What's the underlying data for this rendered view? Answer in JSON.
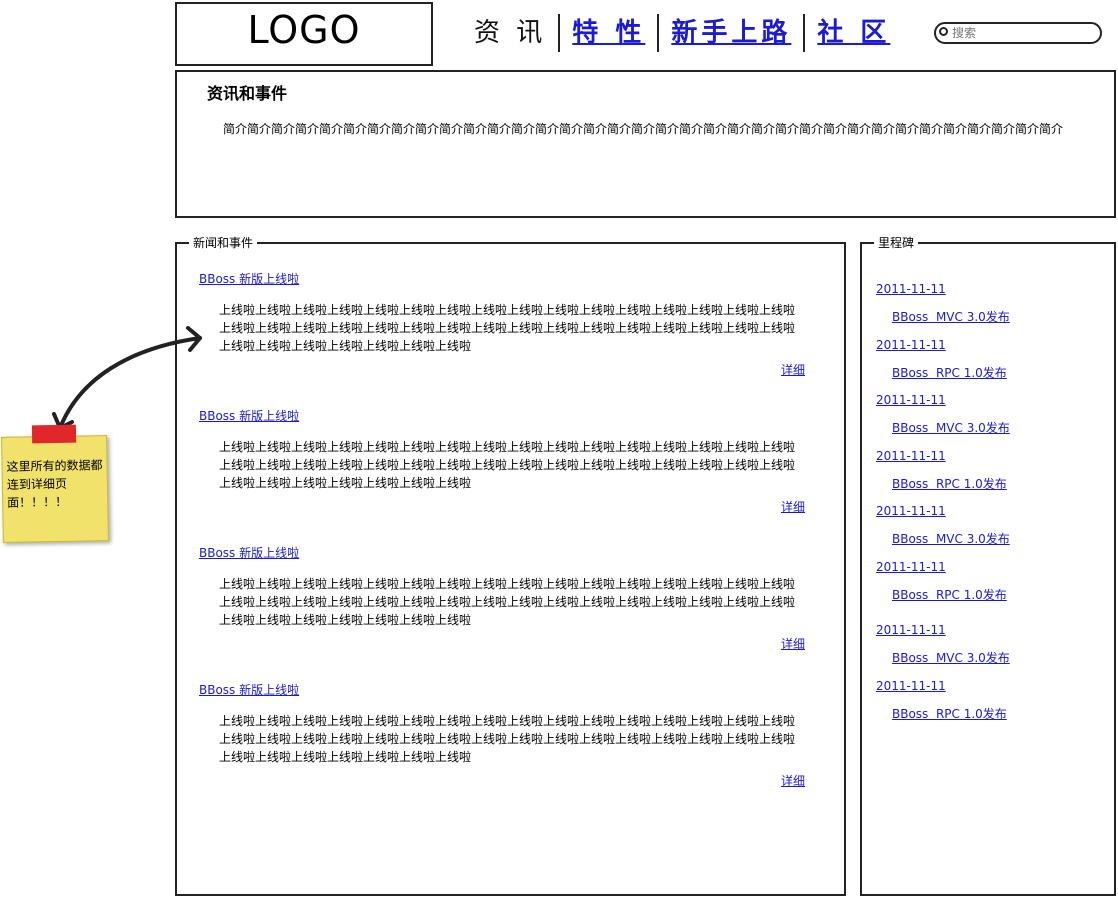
{
  "header": {
    "logo": "LOGO",
    "nav": [
      {
        "label": "资 讯",
        "current": true
      },
      {
        "label": "特 性"
      },
      {
        "label": "新手上路"
      },
      {
        "label": "社 区"
      }
    ],
    "search_placeholder": "搜索"
  },
  "intro": {
    "title": "资讯和事件",
    "text": "简介简介简介简介简介简介简介简介简介简介简介简介简介简介简介简介简介简介简介简介简介简介简介简介简介简介简介简介简介简介简介简介简介简介简介"
  },
  "news": {
    "legend": "新闻和事件",
    "items": [
      {
        "title": "BBoss 新版上线啦",
        "body": "上线啦上线啦上线啦上线啦上线啦上线啦上线啦上线啦上线啦上线啦上线啦上线啦上线啦上线啦上线啦上线啦上线啦上线啦上线啦上线啦上线啦上线啦上线啦上线啦上线啦上线啦上线啦上线啦上线啦上线啦上线啦上线啦上线啦上线啦上线啦上线啦上线啦上线啦上线啦",
        "more": "详细"
      },
      {
        "title": "BBoss 新版上线啦",
        "body": "上线啦上线啦上线啦上线啦上线啦上线啦上线啦上线啦上线啦上线啦上线啦上线啦上线啦上线啦上线啦上线啦上线啦上线啦上线啦上线啦上线啦上线啦上线啦上线啦上线啦上线啦上线啦上线啦上线啦上线啦上线啦上线啦上线啦上线啦上线啦上线啦上线啦上线啦上线啦",
        "more": "详细"
      },
      {
        "title": "BBoss 新版上线啦",
        "body": "上线啦上线啦上线啦上线啦上线啦上线啦上线啦上线啦上线啦上线啦上线啦上线啦上线啦上线啦上线啦上线啦上线啦上线啦上线啦上线啦上线啦上线啦上线啦上线啦上线啦上线啦上线啦上线啦上线啦上线啦上线啦上线啦上线啦上线啦上线啦上线啦上线啦上线啦上线啦",
        "more": "详细"
      },
      {
        "title": "BBoss 新版上线啦",
        "body": "上线啦上线啦上线啦上线啦上线啦上线啦上线啦上线啦上线啦上线啦上线啦上线啦上线啦上线啦上线啦上线啦上线啦上线啦上线啦上线啦上线啦上线啦上线啦上线啦上线啦上线啦上线啦上线啦上线啦上线啦上线啦上线啦上线啦上线啦上线啦上线啦上线啦上线啦上线啦",
        "more": "详细"
      }
    ]
  },
  "milestones": {
    "legend": "里程碑",
    "items": [
      {
        "date": "2011-11-11",
        "title": "BBoss  MVC 3.0发布"
      },
      {
        "date": "2011-11-11",
        "title": "BBoss  RPC 1.0发布"
      },
      {
        "date": "2011-11-11",
        "title": "BBoss  MVC 3.0发布"
      },
      {
        "date": "2011-11-11",
        "title": "BBoss  RPC 1.0发布"
      },
      {
        "date": "2011-11-11",
        "title": "BBoss  MVC 3.0发布"
      },
      {
        "date": "2011-11-11",
        "title": "BBoss  RPC 1.0发布"
      },
      {
        "date": "2011-11-11",
        "title": "BBoss  MVC 3.0发布"
      },
      {
        "date": "2011-11-11",
        "title": "BBoss  RPC 1.0发布"
      }
    ]
  },
  "note": {
    "text": "这里所有的数据都连到详细页面！！！！"
  },
  "colors": {
    "link": "#1b1bd6",
    "note": "#f0e26a",
    "tape": "#e0272a"
  }
}
